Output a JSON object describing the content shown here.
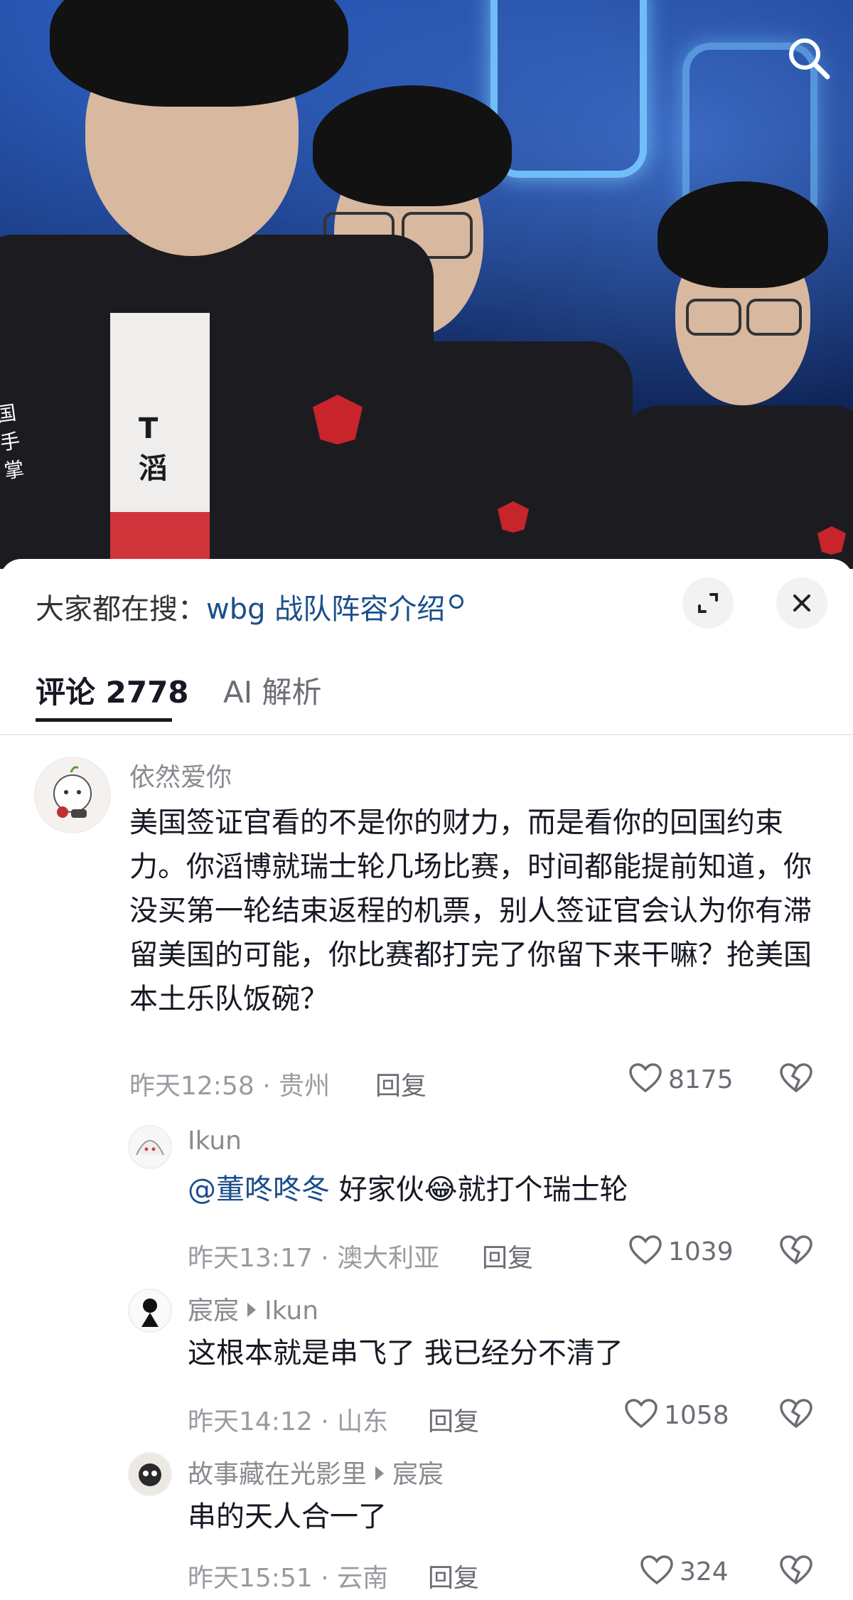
{
  "search_suggestion": {
    "prefix": "大家都在搜：",
    "term": "wbg 战队阵容介绍"
  },
  "tabs": [
    {
      "label": "评论 2778",
      "active": true
    },
    {
      "label": "AI 解析",
      "active": false
    }
  ],
  "colors": {
    "accent_link": "#1b4f8a",
    "team_logo": "#c8242c"
  },
  "hero_text": {
    "badge": "T滔",
    "corner": "国手掌"
  },
  "comments": [
    {
      "user": "依然爱你",
      "text": "美国签证官看的不是你的财力，而是看你的回国约束力。你滔博就瑞士轮几场比赛，时间都能提前知道，你没买第一轮结束返程的机票，别人签证官会认为你有滞留美国的可能，你比赛都打完了你留下来干嘛？抢美国本土乐队饭碗？",
      "time": "昨天12:58",
      "location": "贵州",
      "reply_label": "回复",
      "likes": "8175"
    },
    {
      "user": "Ikun",
      "mention": "@董咚咚冬",
      "text_a": " 好家伙",
      "emoji": "😂",
      "text_b": "就打个瑞士轮",
      "time": "昨天13:17",
      "location": "澳大利亚",
      "reply_label": "回复",
      "likes": "1039"
    },
    {
      "user": "宸宸",
      "reply_to": "Ikun",
      "text": "这根本就是串飞了 我已经分不清了",
      "time": "昨天14:12",
      "location": "山东",
      "reply_label": "回复",
      "likes": "1058"
    },
    {
      "user": "故事藏在光影里",
      "reply_to": "宸宸",
      "text": "串的天人合一了",
      "time": "昨天15:51",
      "location": "云南",
      "reply_label": "回复",
      "likes": "324"
    }
  ]
}
